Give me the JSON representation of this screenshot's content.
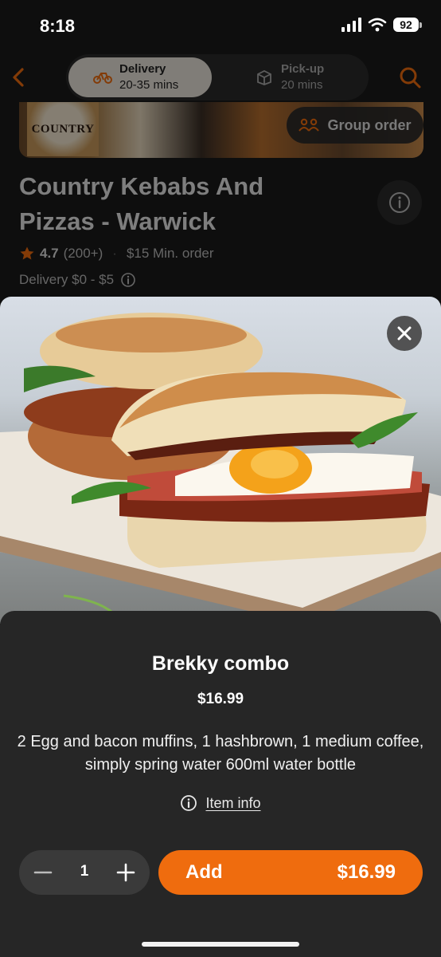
{
  "status_bar": {
    "time": "8:18",
    "battery": "92"
  },
  "nav": {
    "delivery_label": "Delivery",
    "delivery_time": "20-35 mins",
    "pickup_label": "Pick-up",
    "pickup_time": "20 mins"
  },
  "store": {
    "logo_text": "COUNTRY",
    "group_order_label": "Group order",
    "title": "Country Kebabs And Pizzas - Warwick",
    "rating": "4.7",
    "rating_count": "(200+)",
    "min_order": "$15 Min. order",
    "delivery_fee": "Delivery $0 - $5"
  },
  "item": {
    "name": "Brekky combo",
    "price": "$16.99",
    "description": "2 Egg and bacon muffins, 1 hashbrown, 1 medium coffee, simply spring water 600ml water bottle",
    "info_label": "Item info",
    "quantity": "1",
    "add_label": "Add",
    "add_price": "$16.99"
  },
  "colors": {
    "accent": "#ef6c0e",
    "sheet": "#262626",
    "delivery_pill": "#e9e4db"
  }
}
